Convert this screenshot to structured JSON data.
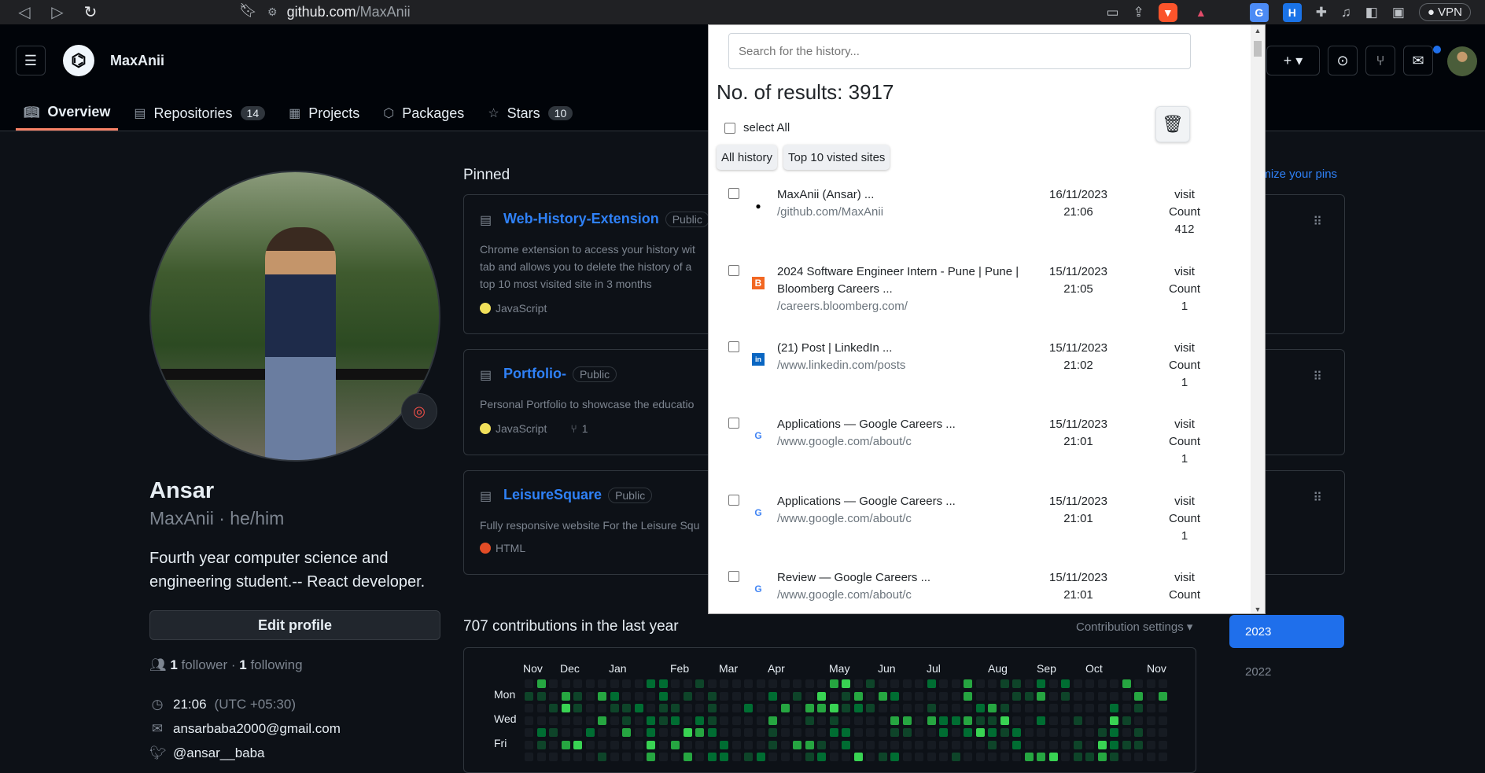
{
  "browser": {
    "url_host": "github.com",
    "url_path": "/MaxAnii",
    "vpn_label": "VPN",
    "notification_count": "1"
  },
  "header": {
    "username": "MaxAnii",
    "tabs": [
      {
        "label": "Overview",
        "icon": "book-icon"
      },
      {
        "label": "Repositories",
        "icon": "repo-icon",
        "count": "14"
      },
      {
        "label": "Projects",
        "icon": "table-icon"
      },
      {
        "label": "Packages",
        "icon": "package-icon"
      },
      {
        "label": "Stars",
        "icon": "star-icon",
        "count": "10"
      }
    ]
  },
  "profile": {
    "name": "Ansar",
    "login": "MaxAnii · he/him",
    "bio": "Fourth year computer science and engineering student.-- React developer.",
    "edit_label": "Edit profile",
    "followers_count": "1",
    "followers_label": "follower",
    "following_count": "1",
    "following_label": "following",
    "time": "21:06",
    "tz": "(UTC +05:30)",
    "email": "ansarbaba2000@gmail.com",
    "twitter": "@ansar__baba"
  },
  "pinned": {
    "title": "Pinned",
    "customize": "omize your pins",
    "cards": [
      {
        "name": "Web-History-Extension",
        "badge": "Public",
        "desc1": "Chrome extension to access your history wit",
        "desc2": "tab and allows you to delete the history of a",
        "desc3": "top 10 most visited site in 3 months",
        "lang": "JavaScript",
        "color": "#f1e05a"
      },
      {
        "name": "Portfolio-",
        "badge": "Public",
        "desc1": "Personal Portfolio to showcase the educatio",
        "lang": "JavaScript",
        "color": "#f1e05a",
        "forks": "1"
      },
      {
        "name": "LeisureSquare",
        "badge": "Public",
        "desc1": "Fully responsive website For the Leisure Squ",
        "lang": "HTML",
        "color": "#e34c26"
      }
    ]
  },
  "contributions": {
    "title": "707 contributions in the last year",
    "settings": "Contribution settings ▾",
    "months": [
      "Nov",
      "Dec",
      "Jan",
      "Feb",
      "Mar",
      "Apr",
      "May",
      "Jun",
      "Jul",
      "Aug",
      "Sep",
      "Oct",
      "Nov"
    ],
    "days": [
      "Mon",
      "Wed",
      "Fri"
    ],
    "years": [
      "2023",
      "2022"
    ]
  },
  "extension": {
    "search_placeholder": "Search for the history...",
    "results_label": "No. of results: 3917",
    "select_all": "select All",
    "tabs": [
      "All history",
      "Top 10 visted sites"
    ],
    "rows": [
      {
        "title": "MaxAnii (Ansar) ...",
        "url": "/github.com/MaxAnii",
        "date": "16/11/2023",
        "time": "21:06",
        "visit1": "visit",
        "visit2": "Count",
        "count": "412",
        "favicon": "github-icon",
        "fav_color": "#000000"
      },
      {
        "title": "2024 Software Engineer Intern - Pune | Pune | Bloomberg Careers ...",
        "url": "/careers.bloomberg.com/",
        "date": "15/11/2023",
        "time": "21:05",
        "visit1": "visit",
        "visit2": "Count",
        "count": "1",
        "favicon": "bloomberg-icon",
        "fav_color": "#f26722"
      },
      {
        "title": "(21) Post | LinkedIn ...",
        "url": "/www.linkedin.com/posts",
        "date": "15/11/2023",
        "time": "21:02",
        "visit1": "visit",
        "visit2": "Count",
        "count": "1",
        "favicon": "linkedin-icon",
        "fav_color": "#0a66c2"
      },
      {
        "title": "Applications — Google Careers ...",
        "url": "/www.google.com/about/c",
        "date": "15/11/2023",
        "time": "21:01",
        "visit1": "visit",
        "visit2": "Count",
        "count": "1",
        "favicon": "google-icon",
        "fav_color": "#4285f4"
      },
      {
        "title": "Applications — Google Careers ...",
        "url": "/www.google.com/about/c",
        "date": "15/11/2023",
        "time": "21:01",
        "visit1": "visit",
        "visit2": "Count",
        "count": "1",
        "favicon": "google-icon",
        "fav_color": "#4285f4"
      },
      {
        "title": "Review — Google Careers ...",
        "url": "/www.google.com/about/c",
        "date": "15/11/2023",
        "time": "21:01",
        "visit1": "visit",
        "visit2": "Count",
        "count": "",
        "favicon": "google-icon",
        "fav_color": "#4285f4"
      }
    ]
  }
}
